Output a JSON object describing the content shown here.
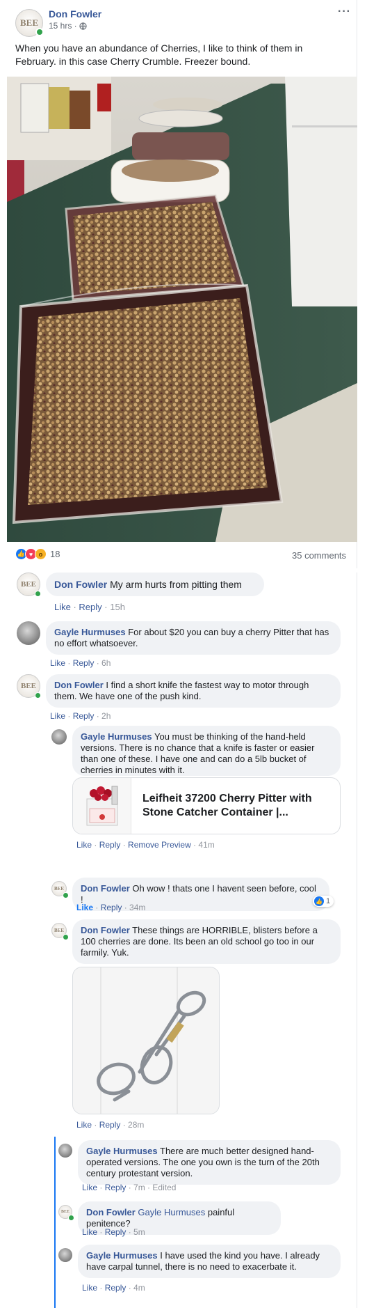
{
  "post": {
    "author": "Don Fowler",
    "meta": "15 hrs ·",
    "more_label": "···",
    "text": "When you have an abundance of Cherries, I like to think of them in February. in this case Cherry Crumble. Freezer bound.",
    "reactions_count": "18",
    "comments_count": "35 comments",
    "avatar_text": "BEE"
  },
  "comments": [
    {
      "author": "Don Fowler",
      "text": "My arm hurts from pitting them",
      "like": "Like",
      "reply": "Reply",
      "time": "15h"
    },
    {
      "author": "Gayle Hurmuses",
      "text": "For about $20 you can buy a cherry Pitter that has no effort whatsoever.",
      "like": "Like",
      "reply": "Reply",
      "time": "6h"
    },
    {
      "author": "Don Fowler",
      "text": "I find a short knife the fastest way to motor through them. We have one of the push kind.",
      "like": "Like",
      "reply": "Reply",
      "time": "2h"
    }
  ],
  "replies": [
    {
      "author": "Gayle Hurmuses",
      "text": "You must be thinking of the hand-held versions. There is no chance that a knife is faster or easier than one of these. I have one and can do a 5lb bucket of cherries in minutes with it.",
      "like": "Like",
      "reply": "Reply",
      "extra": "Remove Preview",
      "time": "41m"
    },
    {
      "author": "Don Fowler",
      "text": "Oh wow ! thats one I havent seen before, cool !",
      "like": "Like",
      "reply": "Reply",
      "time": "34m",
      "reaction_count": "1"
    },
    {
      "author": "Don Fowler",
      "text": "These things are HORRIBLE, blisters before a 100 cherries are done. Its been an old school go too in our farmily. Yuk.",
      "like": "Like",
      "reply": "Reply",
      "time": "28m"
    },
    {
      "author": "Gayle Hurmuses",
      "text": "There are much better designed hand-operated versions. The one you own is the turn of the 20th century protestant version.",
      "like": "Like",
      "reply": "Reply",
      "time": "7m",
      "edited": "Edited"
    },
    {
      "author": "Don Fowler",
      "mention": "Gayle Hurmuses",
      "text": "painful penitence?",
      "like": "Like",
      "reply": "Reply",
      "time": "5m"
    },
    {
      "author": "Gayle Hurmuses",
      "text": "I have used the kind you have. I already have carpal tunnel, there is no need to exacerbate it.",
      "like": "Like",
      "reply": "Reply",
      "time": "4m"
    }
  ],
  "link_preview": {
    "title": "Leifheit 37200 Cherry Pitter with Stone Catcher Container |..."
  },
  "colors": {
    "link_blue": "#385898",
    "online_green": "#31a24c",
    "bubble_bg": "#f0f2f5",
    "thread_line": "#1877f2"
  }
}
